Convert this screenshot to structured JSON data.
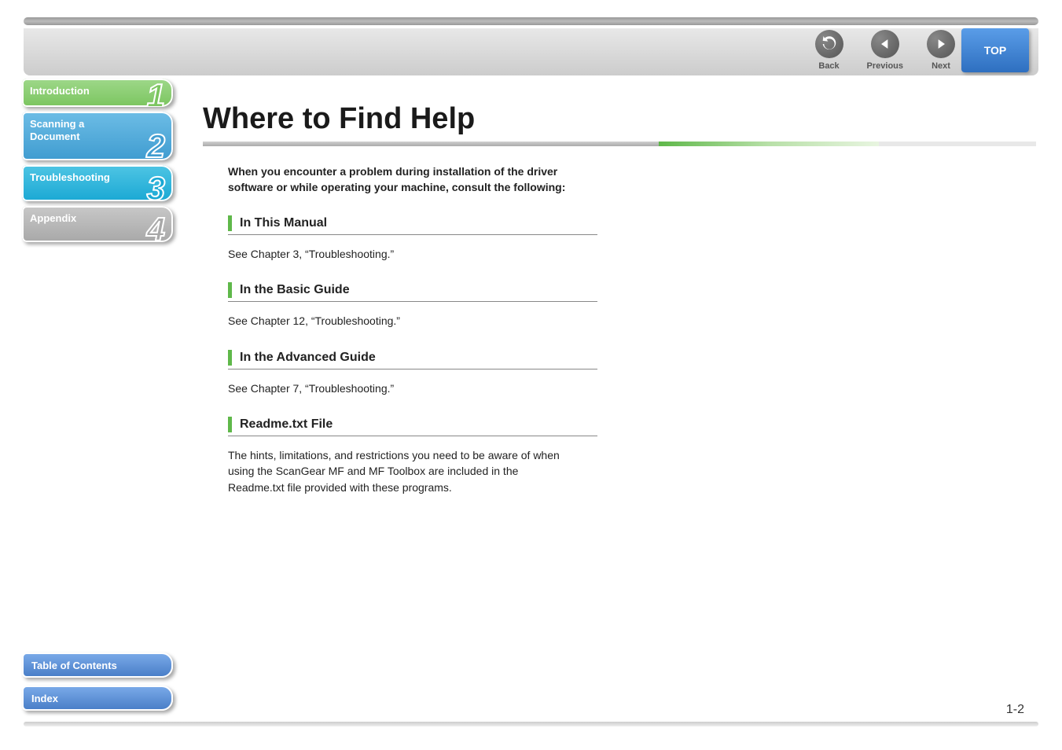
{
  "nav": {
    "back": "Back",
    "previous": "Previous",
    "next": "Next",
    "top": "TOP"
  },
  "sidebar": {
    "intro": {
      "label": "Introduction",
      "num": "1"
    },
    "scan": {
      "label": "Scanning a\nDocument",
      "num": "2"
    },
    "trouble": {
      "label": "Troubleshooting",
      "num": "3"
    },
    "appendix": {
      "label": "Appendix",
      "num": "4"
    }
  },
  "bottom": {
    "toc": "Table of Contents",
    "index": "Index"
  },
  "content": {
    "title": "Where to Find Help",
    "intro": "When you encounter a problem during installation of the driver software or while operating your machine, consult the following:",
    "s1": {
      "title": "In This Manual",
      "body": "See Chapter 3, “Troubleshooting.”"
    },
    "s2": {
      "title": "In the Basic Guide",
      "body": "See Chapter 12, “Troubleshooting.”"
    },
    "s3": {
      "title": "In the Advanced Guide",
      "body": "See Chapter 7, “Troubleshooting.”"
    },
    "s4": {
      "title": "Readme.txt File",
      "body": "The hints, limitations, and restrictions you need to be aware of when using the ScanGear MF and MF Toolbox are included in the Readme.txt file provided with these programs."
    }
  },
  "page_number": "1-2"
}
